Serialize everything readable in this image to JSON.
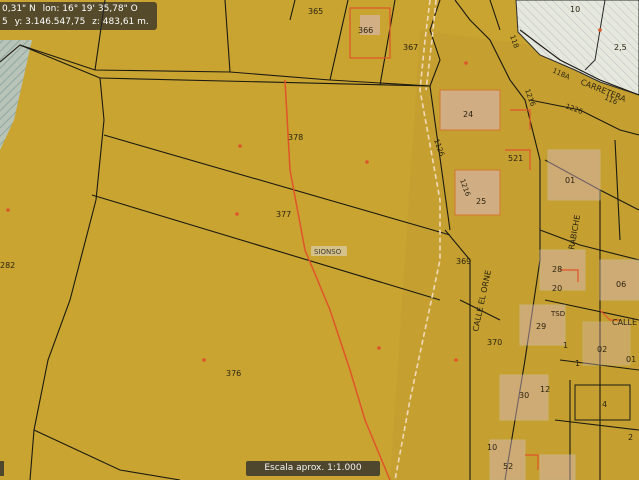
{
  "coordinates": {
    "lat_tail": "0,31\" N",
    "lon": "lon: 16° 19' 35,78\" O",
    "x_prefix": "5",
    "y": "y: 3.146.547,75",
    "z": "z: 483,61 m."
  },
  "scale": {
    "label": "Escala aprox. 1:1.000"
  },
  "parcels": {
    "p365": "365",
    "p366": "366",
    "p367": "367",
    "p378": "378",
    "p377": "377",
    "p376": "376",
    "p282": "282",
    "p369": "369",
    "p370": "370",
    "p24": "24",
    "p25": "25",
    "p521": "521",
    "p01": "01",
    "p28": "28",
    "p20": "20",
    "p06": "06",
    "p29": "29",
    "p02": "02",
    "p01b": "01",
    "p30": "30",
    "p4": "4",
    "p52": "52",
    "p10": "10",
    "p_10_top": "10",
    "p_1": "1",
    "p_12": "12",
    "p_1p": "1",
    "p_2": "2",
    "p_25": "2,5"
  },
  "road_labels": {
    "carretera": "CARRETERA",
    "calle_el_orne": "CALLE EL ORNE",
    "rabiche": "RABICHE",
    "calle": "CALLE"
  },
  "misc_labels": {
    "sons": "SIONSO",
    "tsd": "TSD",
    "r116": "116",
    "r118": "118",
    "r1216": "1216",
    "r1184": "118A",
    "r1126": "1126",
    "r1226": "1226",
    "r1216b": "1216"
  },
  "colors": {
    "map_fill": "#c9a431",
    "parcel_line": "#1c1a12",
    "red_line": "#e0542a",
    "pink_fill": "#d9b8c8",
    "white_zone": "#e9eae0",
    "hatch": "#8aa4a0"
  }
}
